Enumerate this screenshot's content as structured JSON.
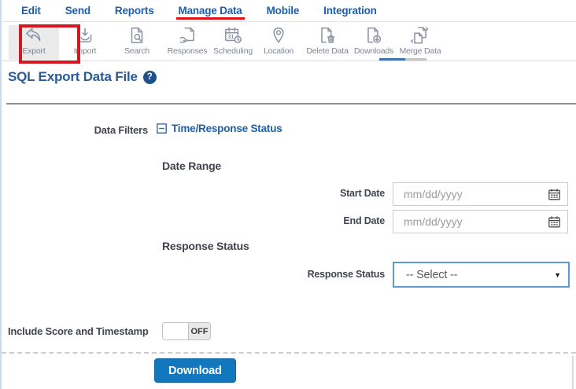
{
  "nav": {
    "items": [
      {
        "label": "Edit",
        "active": false
      },
      {
        "label": "Send",
        "active": false
      },
      {
        "label": "Reports",
        "active": false
      },
      {
        "label": "Manage Data",
        "active": true
      },
      {
        "label": "Mobile",
        "active": false
      },
      {
        "label": "Integration",
        "active": false
      }
    ]
  },
  "toolbar": {
    "items": [
      {
        "label": "Export",
        "icon": "export-icon",
        "highlighted": true
      },
      {
        "label": "Import",
        "icon": "import-icon"
      },
      {
        "label": "Search",
        "icon": "search-icon"
      },
      {
        "label": "Responses",
        "icon": "responses-icon"
      },
      {
        "label": "Scheduling",
        "icon": "scheduling-icon"
      },
      {
        "label": "Location",
        "icon": "location-icon"
      },
      {
        "label": "Delete Data",
        "icon": "delete-data-icon"
      },
      {
        "label": "Downloads",
        "icon": "downloads-icon"
      },
      {
        "label": "Merge Data",
        "icon": "merge-data-icon"
      }
    ],
    "scheduling_day": "31"
  },
  "header": {
    "title": "SQL Export Data File",
    "help_icon": "?"
  },
  "filters": {
    "data_filters_label": "Data Filters",
    "section_toggle_label": "Time/Response Status",
    "collapse_icon": "minus-square-icon",
    "date_range_heading": "Date Range",
    "start_date": {
      "label": "Start Date",
      "value": "",
      "placeholder": "mm/dd/yyyy"
    },
    "end_date": {
      "label": "End Date",
      "value": "",
      "placeholder": "mm/dd/yyyy"
    },
    "response_status_heading": "Response Status",
    "response_status": {
      "label": "Response Status",
      "selected": "-- Select --",
      "arrow": "▼"
    },
    "include_score": {
      "label": "Include Score and Timestamp",
      "state": "OFF"
    }
  },
  "actions": {
    "download_label": "Download"
  },
  "annotations": {
    "red_box_target": "Export toolbar button",
    "red_underline_target": "Manage Data nav tab",
    "annotation_color": "#d6171f"
  },
  "colors": {
    "nav_link": "#1c5fae",
    "title": "#2a5b95",
    "help_badge": "#1d518e",
    "toolbar_icon": "#8b94a5",
    "select_border": "#5b9bd5",
    "download_button": "#1277bd",
    "divider": "#8f8f8f"
  }
}
